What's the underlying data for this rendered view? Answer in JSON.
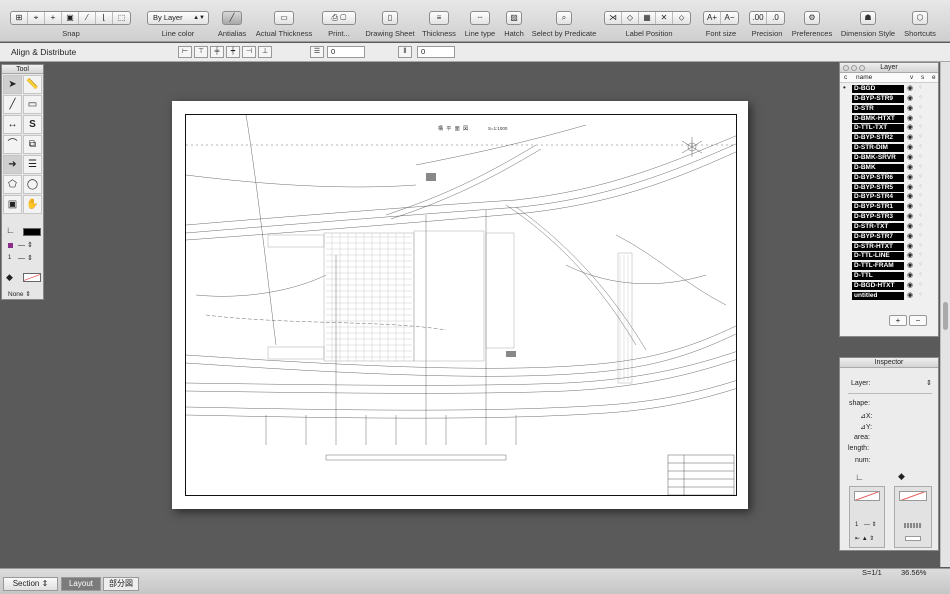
{
  "toolbar": {
    "snap_label": "Snap",
    "line_color_value": "By Layer",
    "line_color_label": "Line color",
    "antialias_label": "Antialias",
    "actual_thickness_label": "Actual Thickness",
    "print_label": "Print...",
    "drawing_sheet_label": "Drawing Sheet",
    "thickness_label": "Thickness",
    "line_type_label": "Line type",
    "hatch_label": "Hatch",
    "select_by_predicate_label": "Select by Predicate",
    "label_position_label": "Label Position",
    "font_size_label": "Font size",
    "precision_label": "Precision",
    "preferences_label": "Preferences",
    "dimension_style_label": "Dimension Style",
    "shortcuts_label": "Shortcuts",
    "font_buttons": [
      "A+",
      "A−"
    ],
    "precision_buttons": [
      ".00",
      ".0"
    ]
  },
  "align": {
    "title": "Align & Distribute",
    "field1": "0",
    "field2": "0"
  },
  "tool_palette": {
    "title": "Tool",
    "line_style_value": "None"
  },
  "drawing": {
    "title": "構 平 面 図",
    "scale": "S=1:1000"
  },
  "layers": {
    "title": "Layer",
    "columns": {
      "c": "c",
      "name": "name",
      "v": "v",
      "s": "s",
      "e": "e"
    },
    "items": [
      "D-BGD",
      "D-BYP-STR9",
      "D-STR",
      "D-BMK-HTXT",
      "D-TTL-TXT",
      "D-BYP-STR2",
      "D-STR-DIM",
      "D-BMK-SRVR",
      "D-BMK",
      "D-BYP-STR6",
      "D-BYP-STR5",
      "D-BYP-STR4",
      "D-BYP-STR1",
      "D-BYP-STR3",
      "D-STR-TXT",
      "D-BYP-STR7",
      "D-STR-HTXT",
      "D-TTL-LINE",
      "D-TTL-FRAM",
      "D-TTL",
      "D-BGD-HTXT",
      "untitled"
    ],
    "add_label": "+",
    "remove_label": "−"
  },
  "inspector": {
    "title": "Inspector",
    "layer_label": "Layer:",
    "shape_label": "shape:",
    "dx_label": "⊿X:",
    "dy_label": "⊿Y:",
    "area_label": "area:",
    "length_label": "length:",
    "num_label": "num:",
    "width_value": "1"
  },
  "status": {
    "section_label": "Section",
    "tab_layout": "Layout",
    "tab_detail": "部分図",
    "scale": "S=1/1",
    "zoom": "36.56%"
  }
}
